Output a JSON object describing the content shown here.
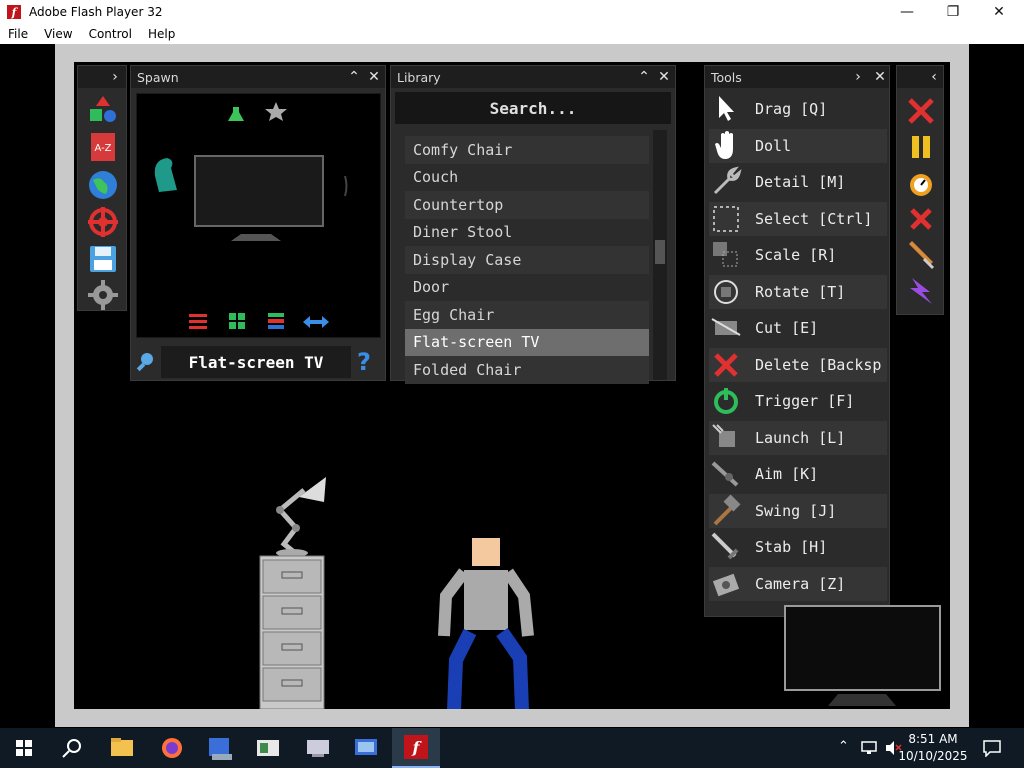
{
  "window": {
    "title": "Adobe Flash Player 32",
    "minimize": "—",
    "restore": "❐",
    "close": "✕"
  },
  "menu": [
    "File",
    "View",
    "Control",
    "Help"
  ],
  "spawn": {
    "title": "Spawn",
    "search_value": "Flat-screen TV",
    "collapse": "⌃",
    "close": "✕"
  },
  "library": {
    "title": "Library",
    "search_label": "Search...",
    "items": [
      "Comfy Chair",
      "Couch",
      "Countertop",
      "Diner Stool",
      "Display Case",
      "Door",
      "Egg Chair",
      "Flat-screen TV",
      "Folded Chair"
    ],
    "selected": "Flat-screen TV"
  },
  "tools": {
    "title": "Tools",
    "items": [
      {
        "label": "Drag [Q]",
        "icon": "cursor-icon"
      },
      {
        "label": "Doll",
        "icon": "hand-icon"
      },
      {
        "label": "Detail [M]",
        "icon": "wrench-icon"
      },
      {
        "label": "Select [Ctrl]",
        "icon": "marquee-icon"
      },
      {
        "label": "Scale [R]",
        "icon": "scale-icon"
      },
      {
        "label": "Rotate [T]",
        "icon": "rotate-icon"
      },
      {
        "label": "Cut [E]",
        "icon": "cut-icon"
      },
      {
        "label": "Delete [Backsp",
        "icon": "delete-icon"
      },
      {
        "label": "Trigger [F]",
        "icon": "power-icon"
      },
      {
        "label": "Launch [L]",
        "icon": "launch-icon"
      },
      {
        "label": "Aim [K]",
        "icon": "aim-icon"
      },
      {
        "label": "Swing [J]",
        "icon": "hammer-icon"
      },
      {
        "label": "Stab [H]",
        "icon": "sword-icon"
      },
      {
        "label": "Camera [Z]",
        "icon": "camera-icon"
      }
    ]
  },
  "clock": {
    "time": "8:51 AM",
    "date": "10/10/2025"
  },
  "colors": {
    "red": "#e03030",
    "green": "#2ebd5a",
    "blue": "#2f6fd8",
    "yellow": "#f0c020",
    "panel": "#2b2b2b"
  }
}
